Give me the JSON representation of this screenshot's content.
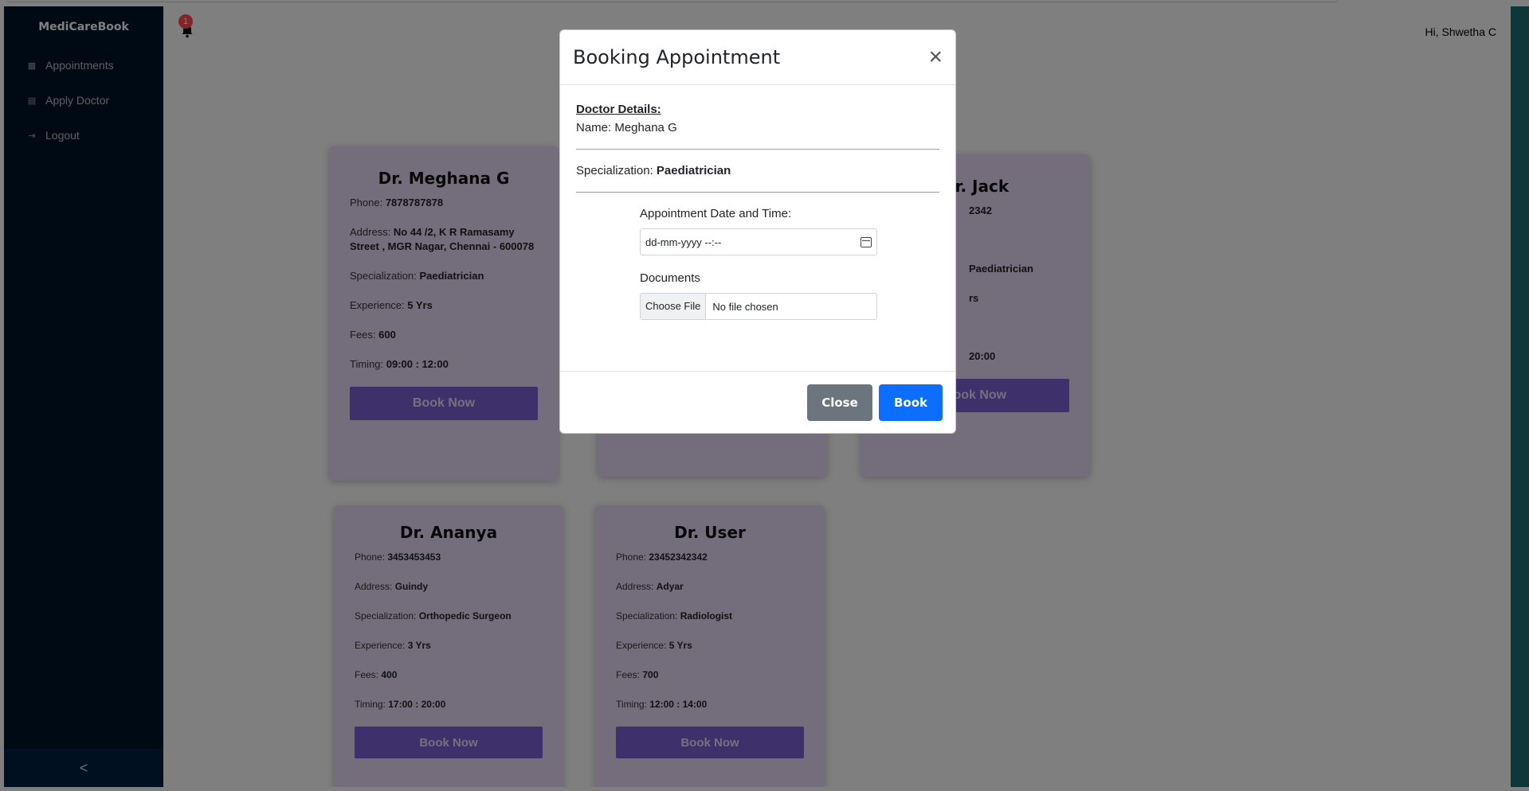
{
  "sidebar": {
    "brand": "MediCareBook",
    "items": [
      {
        "label": "Appointments",
        "icon": "calendar-icon"
      },
      {
        "label": "Apply Doctor",
        "icon": "doctor-icon"
      },
      {
        "label": "Logout",
        "icon": "logout-icon"
      }
    ],
    "collapse_glyph": "<"
  },
  "header": {
    "notification_count": "1",
    "greeting": "Hi, Shwetha C"
  },
  "labels": {
    "phone": "Phone: ",
    "address": "Address: ",
    "specialization": "Specialization: ",
    "experience": "Experience: ",
    "fees": "Fees: ",
    "timing": "Timing: ",
    "book_now": "Book Now"
  },
  "doctors": [
    {
      "name": "Dr. Meghana G",
      "phone": "7878787878",
      "address": "No 44 /2, K R Ramasamy Street , MGR Nagar, Chennai - 600078",
      "specialization": "Paediatrician",
      "experience": "5 Yrs",
      "fees": "600",
      "timing": "09:00 : 12:00"
    },
    {
      "name": "Dr. Jack",
      "phone": "2342",
      "specialization": "Paediatrician",
      "experience": "rs",
      "timing": "20:00"
    },
    {
      "name": "Dr. Ananya",
      "phone": "3453453453",
      "address": "Guindy",
      "specialization": "Orthopedic Surgeon",
      "experience": "3 Yrs",
      "fees": "400",
      "timing": "17:00 : 20:00"
    },
    {
      "name": "Dr. User",
      "phone": "23452342342",
      "address": "Adyar",
      "specialization": "Radiologist",
      "experience": "5 Yrs",
      "fees": "700",
      "timing": "12:00 : 14:00"
    }
  ],
  "modal": {
    "title": "Booking Appointment",
    "close_glyph": "×",
    "doctor_details_heading": "Doctor Details:",
    "name_line": "Name: Meghana G",
    "specialization_label": "Specialization: ",
    "specialization_value": "Paediatrician",
    "date_label": "Appointment Date and Time:",
    "date_placeholder": "dd-mm-yyyy --:--",
    "documents_label": "Documents",
    "choose_file_label": "Choose File",
    "no_file_text": "No file chosen",
    "close_button": "Close",
    "book_button": "Book"
  },
  "colors": {
    "sidebar_bg": "#001529",
    "card_bg": "#e7dbf8",
    "book_now_bg": "#7b61d6",
    "close_button_bg": "#6c757d",
    "book_button_bg": "#0d6efd",
    "badge_bg": "#ff4d4f"
  }
}
